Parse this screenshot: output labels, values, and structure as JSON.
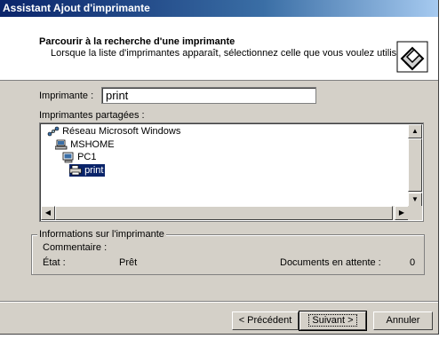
{
  "window": {
    "title": "Assistant Ajout d'imprimante"
  },
  "header": {
    "title": "Parcourir à la recherche d'une imprimante",
    "subtitle": "Lorsque la liste d'imprimantes apparaît, sélectionnez celle que vous voulez utiliser.",
    "icon": "printer-wizard-icon"
  },
  "printer_field": {
    "label": "Imprimante :",
    "value": "print"
  },
  "shared": {
    "label": "Imprimantes partagées :",
    "items": [
      {
        "label": "Réseau Microsoft Windows",
        "icon": "network-icon"
      },
      {
        "label": "MSHOME",
        "icon": "workgroup-icon"
      },
      {
        "label": "PC1",
        "icon": "computer-icon"
      },
      {
        "label": "print",
        "icon": "printer-icon",
        "selected": true
      }
    ]
  },
  "info": {
    "title": "Informations sur l'imprimante",
    "comment_label": "Commentaire :",
    "state_label": "État :",
    "state_value": "Prêt",
    "docs_label": "Documents en attente :",
    "docs_value": "0"
  },
  "buttons": {
    "back": "< Précédent",
    "next": "Suivant >",
    "cancel": "Annuler"
  }
}
